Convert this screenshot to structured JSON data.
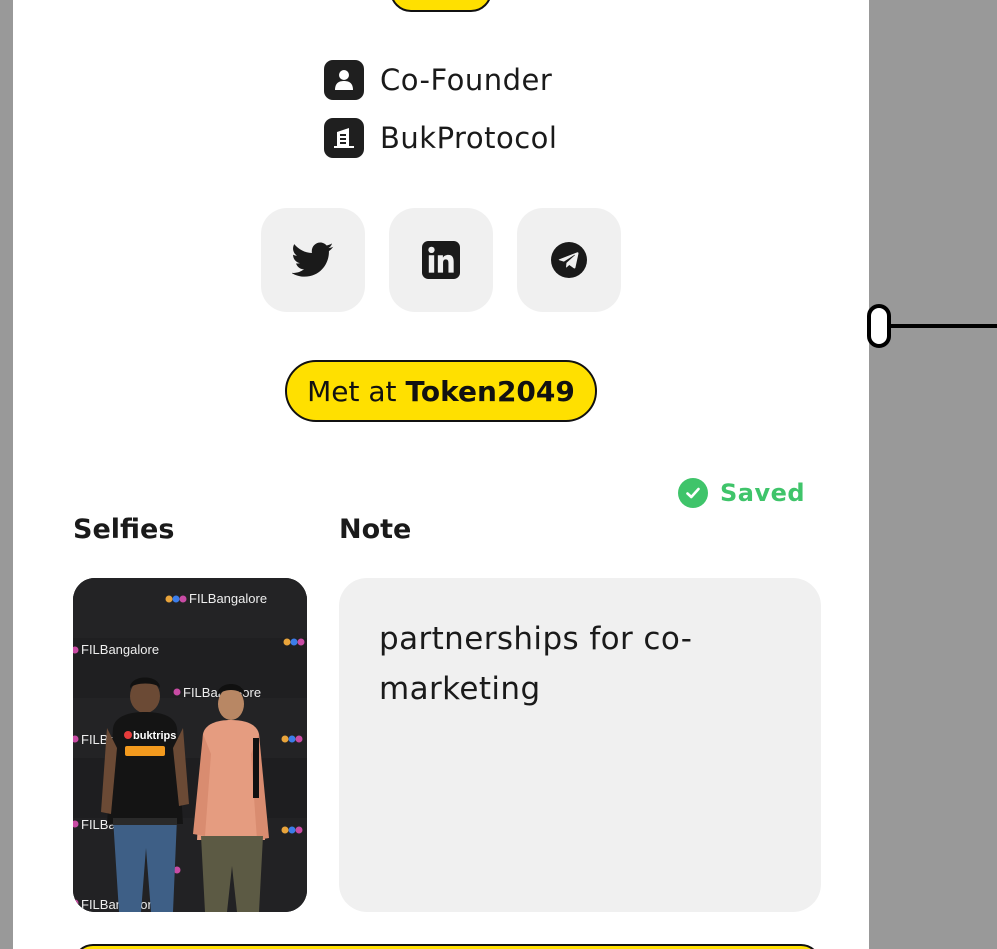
{
  "profile": {
    "role": "Co-Founder",
    "company": "BukProtocol"
  },
  "socials": [
    {
      "name": "twitter",
      "icon": "twitter-icon"
    },
    {
      "name": "linkedin",
      "icon": "linkedin-icon"
    },
    {
      "name": "telegram",
      "icon": "telegram-icon"
    }
  ],
  "met_at": {
    "prefix": "Met at",
    "event": "Token2049"
  },
  "status": {
    "saved_label": "Saved",
    "icon": "check-circle-icon"
  },
  "sections": {
    "selfies_title": "Selfies",
    "note_title": "Note"
  },
  "selfie": {
    "banner_text": "FILBangalore",
    "shirt_text": "buktrips"
  },
  "note": {
    "text": " partnerships for co-marketing"
  },
  "colors": {
    "accent_yellow": "#FFE000",
    "saved_green": "#3fc46a",
    "icon_dark": "#1f1f1f",
    "tile_bg": "#f0f0f0",
    "backdrop": "#999999"
  }
}
